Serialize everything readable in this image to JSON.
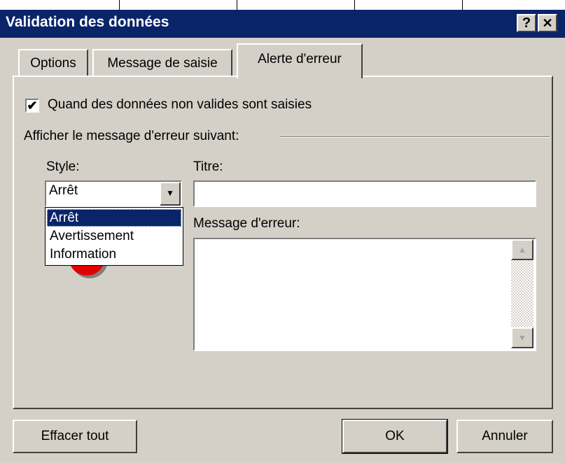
{
  "window": {
    "title": "Validation des données",
    "help_btn": "?",
    "close_btn": "✕"
  },
  "tabs": [
    {
      "label": "Options",
      "active": false
    },
    {
      "label": "Message de saisie",
      "active": false
    },
    {
      "label": "Alerte d'erreur",
      "active": true
    }
  ],
  "checkbox": {
    "checked": true,
    "mark": "✔",
    "label": "Quand des données non valides sont saisies"
  },
  "group_label": "Afficher le message d'erreur suivant:",
  "style": {
    "label": "Style:",
    "value": "Arrêt",
    "options": [
      "Arrêt",
      "Avertissement",
      "Information"
    ],
    "selected_index": 0
  },
  "titre": {
    "label": "Titre:",
    "value": ""
  },
  "message": {
    "label": "Message d'erreur:",
    "value": ""
  },
  "buttons": {
    "clear": "Effacer tout",
    "ok": "OK",
    "cancel": "Annuler"
  },
  "colors": {
    "titlebar": "#0a246a",
    "face": "#d4d0c8",
    "selection": "#0a246a",
    "stop_icon": "#e00000"
  },
  "icons": {
    "dropdown": "chevron-down-icon",
    "scroll_up": "arrow-up-icon",
    "scroll_down": "arrow-down-icon",
    "style_preview": "stop-icon"
  }
}
